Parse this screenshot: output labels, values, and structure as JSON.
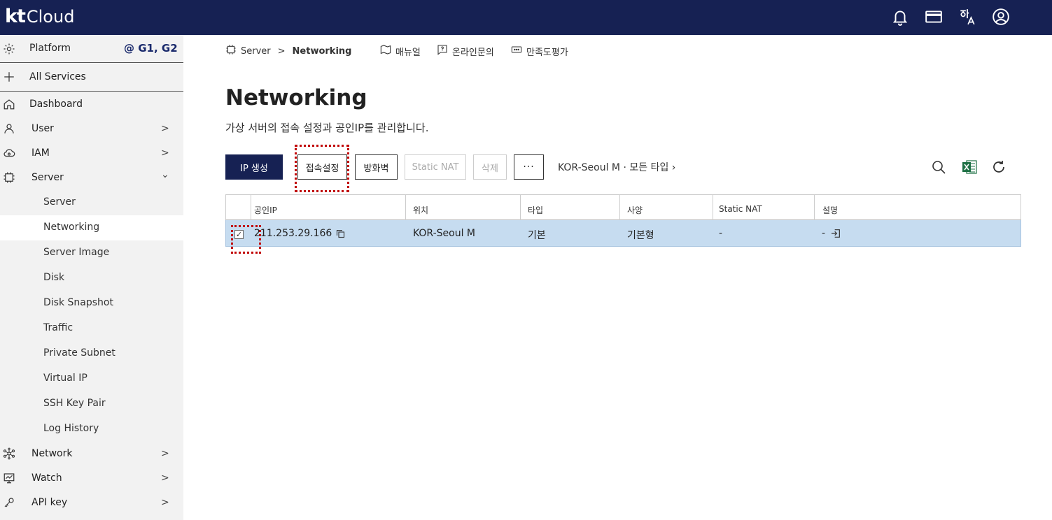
{
  "header": {
    "brand_kt": "kt",
    "brand_cloud": "Cloud",
    "icons": [
      "bell-icon",
      "card-icon",
      "language-icon",
      "account-icon"
    ],
    "brand_color": "#162153"
  },
  "sidebar": {
    "platform_label": "Platform",
    "platform_tag": "@ G1, G2",
    "all_services_label": "All Services",
    "items": [
      {
        "label": "Dashboard",
        "icon": "home-icon"
      },
      {
        "label": "User",
        "icon": "user-icon",
        "chevron": ">"
      },
      {
        "label": "IAM",
        "icon": "cloud-icon",
        "chevron": ">"
      },
      {
        "label": "Server",
        "icon": "chip-icon",
        "chevron": "⌄"
      },
      {
        "label": "Network",
        "icon": "network-icon",
        "chevron": ">"
      },
      {
        "label": "Watch",
        "icon": "monitor-icon",
        "chevron": ">"
      },
      {
        "label": "API key",
        "icon": "key-icon",
        "chevron": ">"
      }
    ],
    "server_sub": [
      "Server",
      "Networking",
      "Server Image",
      "Disk",
      "Disk Snapshot",
      "Traffic",
      "Private Subnet",
      "Virtual IP",
      "SSH Key Pair",
      "Log History"
    ],
    "active_sub": "Networking"
  },
  "breadcrumb": {
    "root": "Server",
    "separator": ">",
    "current": "Networking",
    "manual": "매뉴얼",
    "inquiry": "온라인문의",
    "survey": "만족도평가"
  },
  "page": {
    "title": "Networking",
    "description": "가상 서버의 접속 설정과 공인IP를 관리합니다."
  },
  "toolbar": {
    "create_ip": "IP 생성",
    "access_settings": "접속설정",
    "firewall": "방화벽",
    "static_nat": "Static NAT",
    "delete": "삭제",
    "more": "···",
    "filter": "KOR-Seoul M · 모든 타입 ›"
  },
  "table": {
    "headers": [
      "공인IP",
      "위치",
      "타입",
      "사양",
      "Static NAT",
      "설명"
    ],
    "rows": [
      {
        "checked": "✓",
        "ip": "211.253.29.166",
        "location": "KOR-Seoul M",
        "type": "기본",
        "spec": "기본형",
        "static_nat": "-",
        "desc": "-"
      }
    ]
  }
}
